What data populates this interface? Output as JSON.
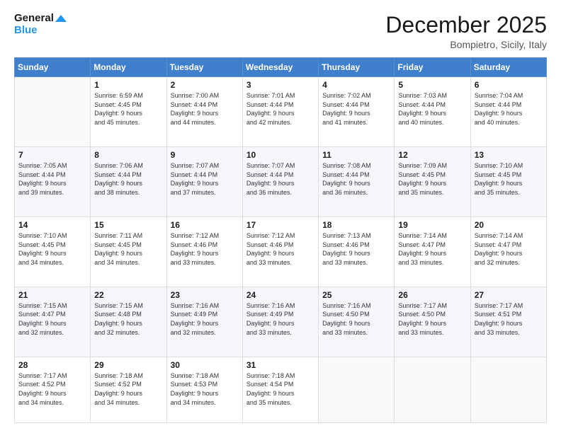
{
  "logo": {
    "line1": "General",
    "line2": "Blue"
  },
  "title": "December 2025",
  "location": "Bompietro, Sicily, Italy",
  "days_header": [
    "Sunday",
    "Monday",
    "Tuesday",
    "Wednesday",
    "Thursday",
    "Friday",
    "Saturday"
  ],
  "weeks": [
    [
      {
        "day": "",
        "info": ""
      },
      {
        "day": "1",
        "info": "Sunrise: 6:59 AM\nSunset: 4:45 PM\nDaylight: 9 hours\nand 45 minutes."
      },
      {
        "day": "2",
        "info": "Sunrise: 7:00 AM\nSunset: 4:44 PM\nDaylight: 9 hours\nand 44 minutes."
      },
      {
        "day": "3",
        "info": "Sunrise: 7:01 AM\nSunset: 4:44 PM\nDaylight: 9 hours\nand 42 minutes."
      },
      {
        "day": "4",
        "info": "Sunrise: 7:02 AM\nSunset: 4:44 PM\nDaylight: 9 hours\nand 41 minutes."
      },
      {
        "day": "5",
        "info": "Sunrise: 7:03 AM\nSunset: 4:44 PM\nDaylight: 9 hours\nand 40 minutes."
      },
      {
        "day": "6",
        "info": "Sunrise: 7:04 AM\nSunset: 4:44 PM\nDaylight: 9 hours\nand 40 minutes."
      }
    ],
    [
      {
        "day": "7",
        "info": "Sunrise: 7:05 AM\nSunset: 4:44 PM\nDaylight: 9 hours\nand 39 minutes."
      },
      {
        "day": "8",
        "info": "Sunrise: 7:06 AM\nSunset: 4:44 PM\nDaylight: 9 hours\nand 38 minutes."
      },
      {
        "day": "9",
        "info": "Sunrise: 7:07 AM\nSunset: 4:44 PM\nDaylight: 9 hours\nand 37 minutes."
      },
      {
        "day": "10",
        "info": "Sunrise: 7:07 AM\nSunset: 4:44 PM\nDaylight: 9 hours\nand 36 minutes."
      },
      {
        "day": "11",
        "info": "Sunrise: 7:08 AM\nSunset: 4:44 PM\nDaylight: 9 hours\nand 36 minutes."
      },
      {
        "day": "12",
        "info": "Sunrise: 7:09 AM\nSunset: 4:45 PM\nDaylight: 9 hours\nand 35 minutes."
      },
      {
        "day": "13",
        "info": "Sunrise: 7:10 AM\nSunset: 4:45 PM\nDaylight: 9 hours\nand 35 minutes."
      }
    ],
    [
      {
        "day": "14",
        "info": "Sunrise: 7:10 AM\nSunset: 4:45 PM\nDaylight: 9 hours\nand 34 minutes."
      },
      {
        "day": "15",
        "info": "Sunrise: 7:11 AM\nSunset: 4:45 PM\nDaylight: 9 hours\nand 34 minutes."
      },
      {
        "day": "16",
        "info": "Sunrise: 7:12 AM\nSunset: 4:46 PM\nDaylight: 9 hours\nand 33 minutes."
      },
      {
        "day": "17",
        "info": "Sunrise: 7:12 AM\nSunset: 4:46 PM\nDaylight: 9 hours\nand 33 minutes."
      },
      {
        "day": "18",
        "info": "Sunrise: 7:13 AM\nSunset: 4:46 PM\nDaylight: 9 hours\nand 33 minutes."
      },
      {
        "day": "19",
        "info": "Sunrise: 7:14 AM\nSunset: 4:47 PM\nDaylight: 9 hours\nand 33 minutes."
      },
      {
        "day": "20",
        "info": "Sunrise: 7:14 AM\nSunset: 4:47 PM\nDaylight: 9 hours\nand 32 minutes."
      }
    ],
    [
      {
        "day": "21",
        "info": "Sunrise: 7:15 AM\nSunset: 4:47 PM\nDaylight: 9 hours\nand 32 minutes."
      },
      {
        "day": "22",
        "info": "Sunrise: 7:15 AM\nSunset: 4:48 PM\nDaylight: 9 hours\nand 32 minutes."
      },
      {
        "day": "23",
        "info": "Sunrise: 7:16 AM\nSunset: 4:49 PM\nDaylight: 9 hours\nand 32 minutes."
      },
      {
        "day": "24",
        "info": "Sunrise: 7:16 AM\nSunset: 4:49 PM\nDaylight: 9 hours\nand 33 minutes."
      },
      {
        "day": "25",
        "info": "Sunrise: 7:16 AM\nSunset: 4:50 PM\nDaylight: 9 hours\nand 33 minutes."
      },
      {
        "day": "26",
        "info": "Sunrise: 7:17 AM\nSunset: 4:50 PM\nDaylight: 9 hours\nand 33 minutes."
      },
      {
        "day": "27",
        "info": "Sunrise: 7:17 AM\nSunset: 4:51 PM\nDaylight: 9 hours\nand 33 minutes."
      }
    ],
    [
      {
        "day": "28",
        "info": "Sunrise: 7:17 AM\nSunset: 4:52 PM\nDaylight: 9 hours\nand 34 minutes."
      },
      {
        "day": "29",
        "info": "Sunrise: 7:18 AM\nSunset: 4:52 PM\nDaylight: 9 hours\nand 34 minutes."
      },
      {
        "day": "30",
        "info": "Sunrise: 7:18 AM\nSunset: 4:53 PM\nDaylight: 9 hours\nand 34 minutes."
      },
      {
        "day": "31",
        "info": "Sunrise: 7:18 AM\nSunset: 4:54 PM\nDaylight: 9 hours\nand 35 minutes."
      },
      {
        "day": "",
        "info": ""
      },
      {
        "day": "",
        "info": ""
      },
      {
        "day": "",
        "info": ""
      }
    ]
  ]
}
